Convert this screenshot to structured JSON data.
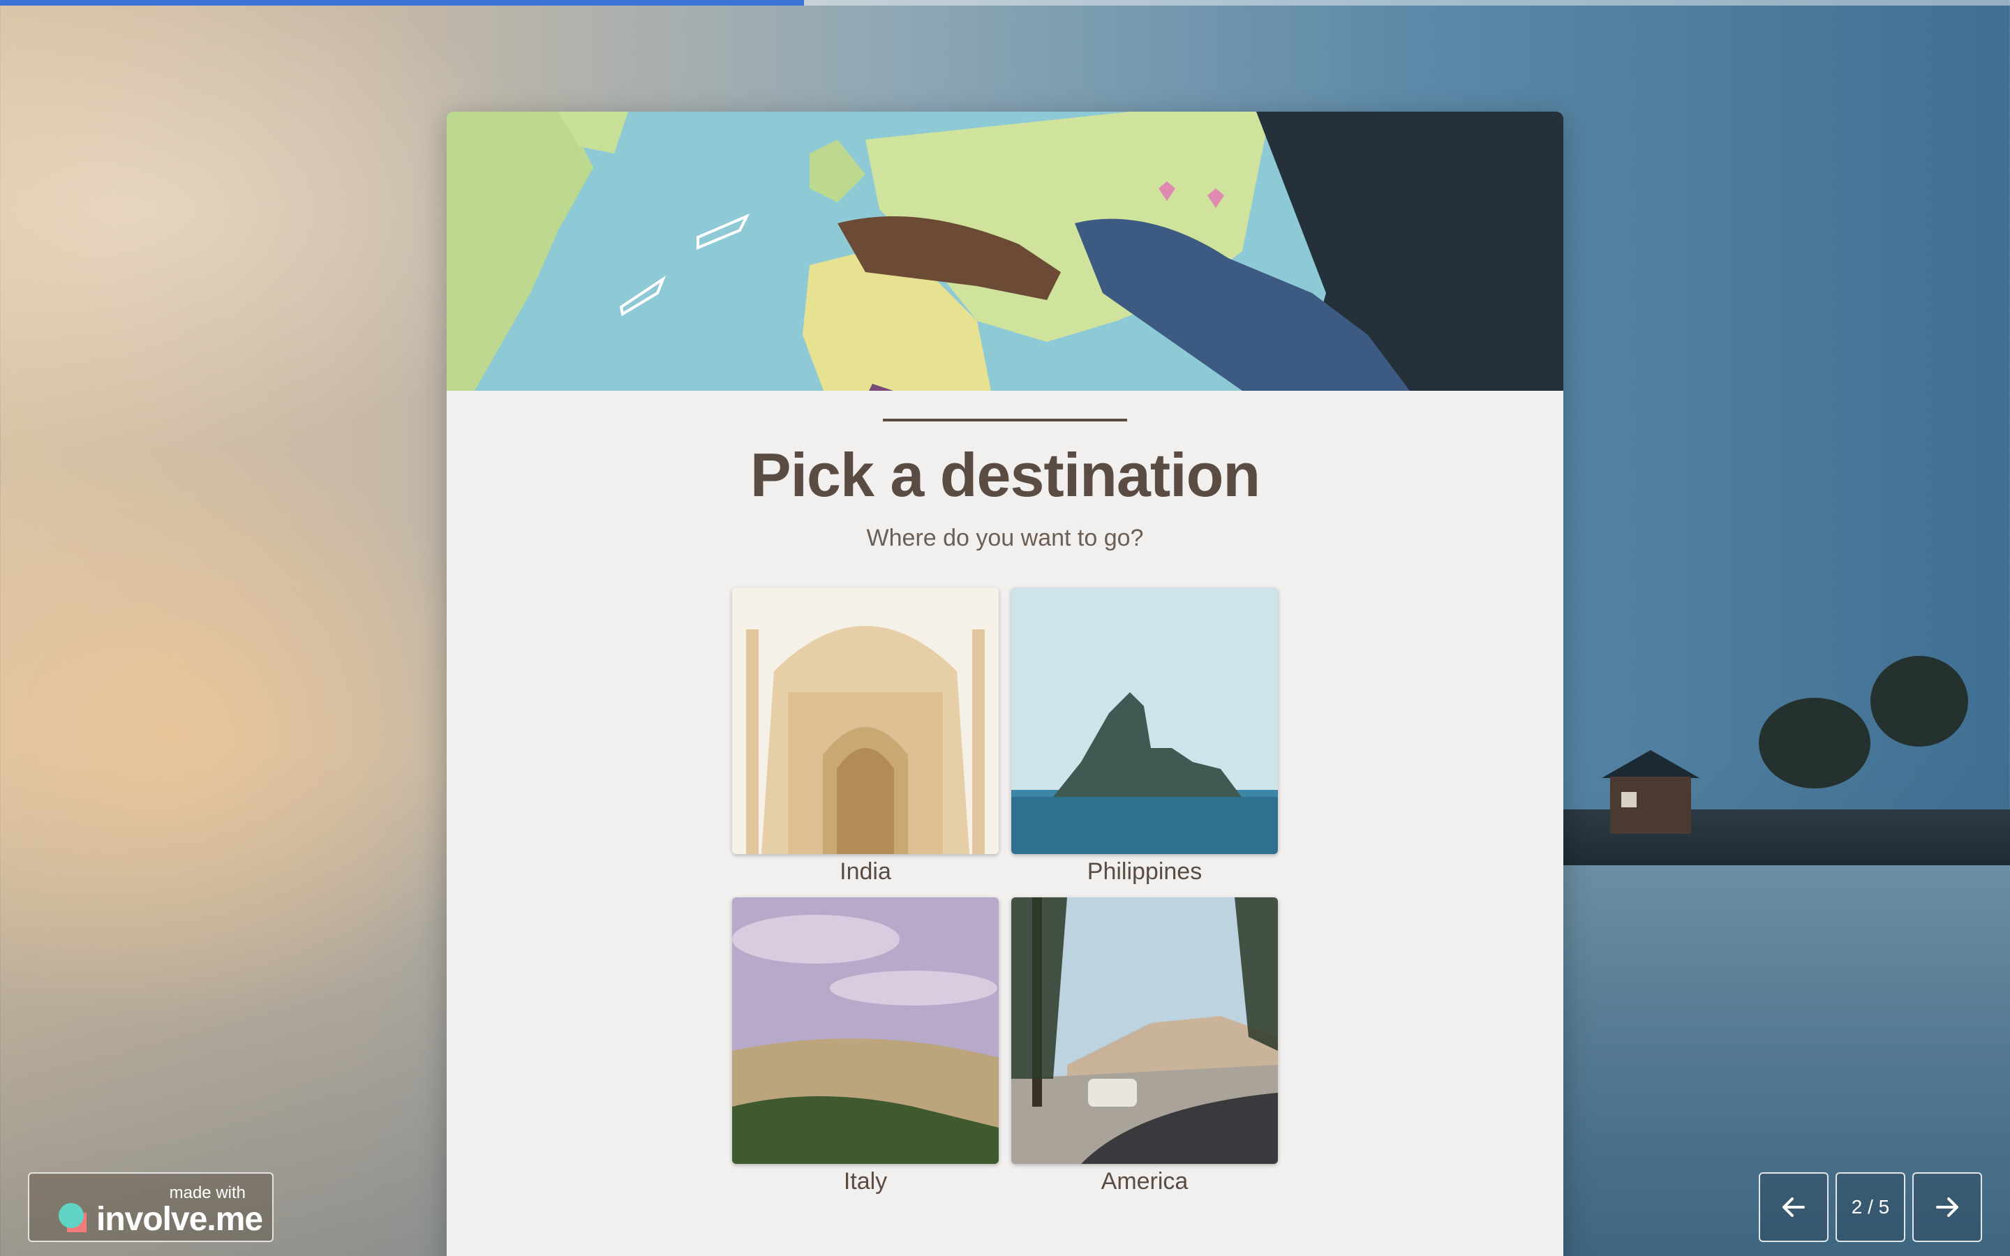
{
  "progress": {
    "percent": 40
  },
  "hero": {
    "image": "world-map-with-hand"
  },
  "question": {
    "title": "Pick a destination",
    "subtitle": "Where do you want to go?"
  },
  "options": [
    {
      "label": "India",
      "image": "taj-mahal-photo"
    },
    {
      "label": "Philippines",
      "image": "island-sea-photo"
    },
    {
      "label": "Italy",
      "image": "tuscany-hills-photo"
    },
    {
      "label": "America",
      "image": "mountain-road-photo"
    }
  ],
  "badge": {
    "made_with": "made with",
    "brand": "involve.me"
  },
  "navigation": {
    "prev_icon": "arrow-left-icon",
    "next_icon": "arrow-right-icon",
    "counter": "2 / 5"
  },
  "colors": {
    "title": "#5a4c42",
    "progress": "#3b73d6",
    "card": "#f2f0ee"
  }
}
